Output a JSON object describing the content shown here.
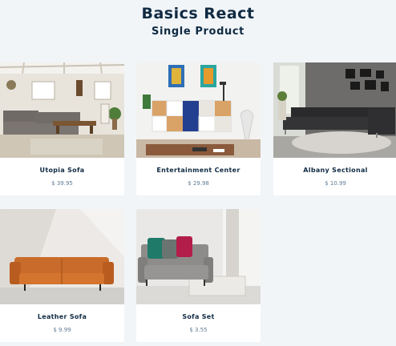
{
  "header": {
    "title": "Basics React",
    "subtitle": "Single Product"
  },
  "products": [
    {
      "name": "Utopia Sofa",
      "price": "$ 39.95",
      "image": "living-room-sectional-image"
    },
    {
      "name": "Entertainment Center",
      "price": "$ 29.98",
      "image": "entertainment-center-image"
    },
    {
      "name": "Albany Sectional",
      "price": "$ 10.99",
      "image": "dark-sectional-image"
    },
    {
      "name": "Leather Sofa",
      "price": "$ 9.99",
      "image": "leather-sofa-image"
    },
    {
      "name": "Sofa Set",
      "price": "$ 3.55",
      "image": "grey-sofa-image"
    }
  ]
}
